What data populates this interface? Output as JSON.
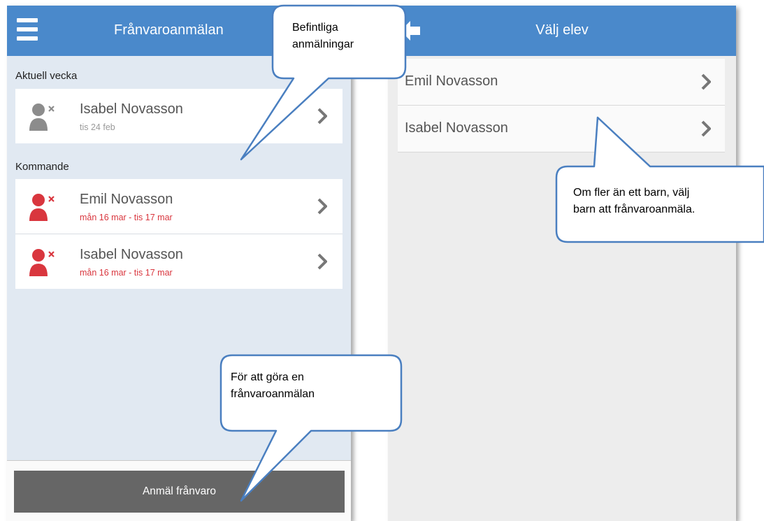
{
  "left_screen": {
    "title": "Frånvaroanmälan",
    "sections": [
      {
        "header": "Aktuell vecka",
        "items": [
          {
            "name": "Isabel Novasson",
            "date": "tis 24 feb",
            "status": "past"
          }
        ]
      },
      {
        "header": "Kommande",
        "items": [
          {
            "name": "Emil Novasson",
            "date": "mån 16 mar - tis 17 mar",
            "status": "upcoming"
          },
          {
            "name": "Isabel Novasson",
            "date": "mån 16 mar - tis 17 mar",
            "status": "upcoming"
          }
        ]
      }
    ],
    "report_button_label": "Anmäl frånvaro"
  },
  "right_screen": {
    "title": "Välj elev",
    "students": [
      "Emil Novasson",
      "Isabel Novasson"
    ]
  },
  "callouts": {
    "existing": [
      "Befintliga",
      "anmälningar"
    ],
    "report": [
      "För att göra en",
      "frånvaroanmälan"
    ],
    "choose": [
      "Om fler än ett barn, välj",
      "barn att frånvaroanmäla."
    ]
  },
  "icons": {
    "menu": "hamburger-menu-icon",
    "back": "back-arrow-icon",
    "person_absent": "person-x-icon",
    "chevron": "chevron-right-icon"
  },
  "colors": {
    "header_blue": "#4a89cb",
    "list_background": "#e1e9f2",
    "past_icon_gray": "#8c8c8c",
    "upcoming_red": "#d9363e",
    "button_gray": "#666666",
    "callout_border": "#4a7fc0"
  }
}
